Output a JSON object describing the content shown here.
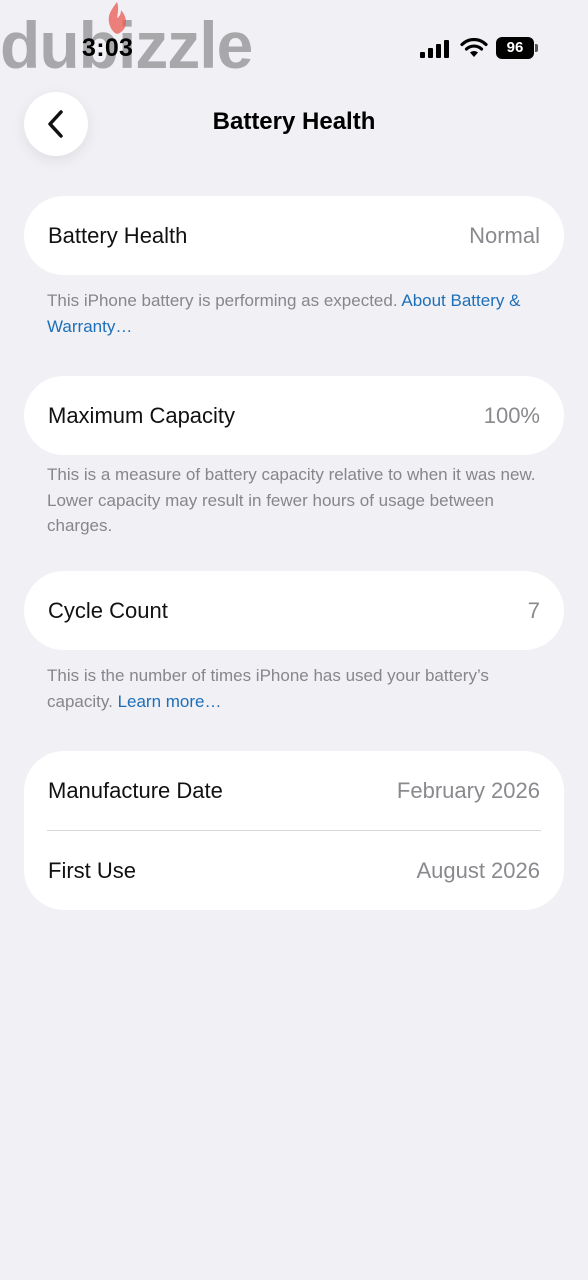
{
  "watermark": {
    "text": "dubizzle"
  },
  "status_bar": {
    "time": "3:03",
    "battery_level": "96"
  },
  "nav": {
    "title": "Battery Health"
  },
  "battery_health": {
    "label": "Battery Health",
    "value": "Normal",
    "caption_text": "This iPhone battery is performing as expected. ",
    "caption_link": "About Battery & Warranty…"
  },
  "maximum_capacity": {
    "label": "Maximum Capacity",
    "value": "100%",
    "caption_text": "This is a measure of battery capacity relative to when it was new. Lower capacity may result in fewer hours of usage between charges."
  },
  "cycle_count": {
    "label": "Cycle Count",
    "value": "7",
    "caption_text": "This is the number of times iPhone has used your battery’s capacity. ",
    "caption_link": "Learn more…"
  },
  "dates": {
    "manufacture_label": "Manufacture Date",
    "manufacture_value": "February 2026",
    "first_use_label": "First Use",
    "first_use_value": "August 2026"
  },
  "colors": {
    "link": "#1d6fb8",
    "background": "#f0f0f5",
    "secondary_text": "#8a8a8e"
  },
  "icons": [
    "cellular-signal-icon",
    "wifi-icon",
    "battery-icon",
    "chevron-left-icon",
    "flame-logo-icon"
  ]
}
